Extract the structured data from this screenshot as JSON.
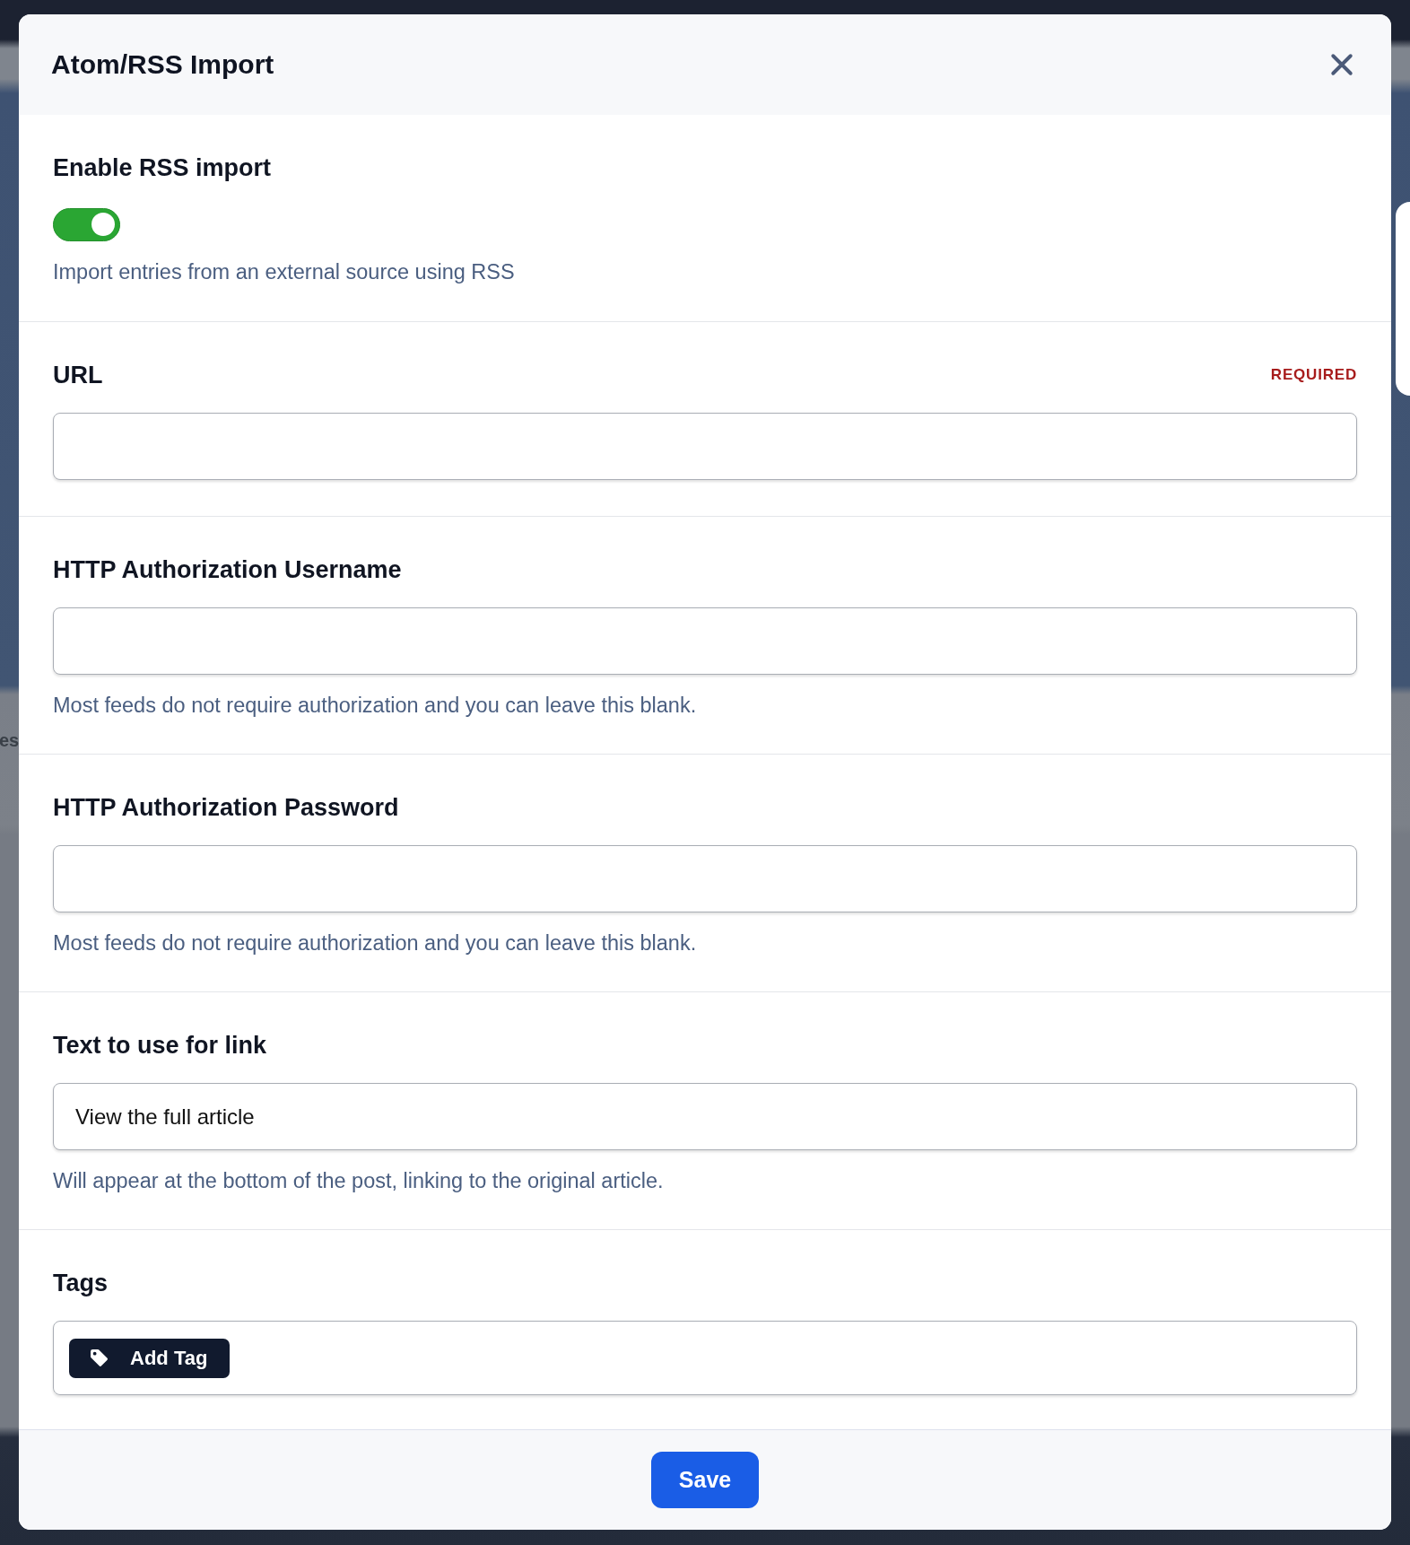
{
  "background": {
    "text_fragment": "es"
  },
  "dialog": {
    "title": "Atom/RSS Import"
  },
  "enable_import": {
    "label": "Enable RSS import",
    "on": true,
    "help": "Import entries from an external source using RSS"
  },
  "fields": [
    {
      "label": "URL",
      "badge": "REQUIRED"
    },
    {
      "label": "HTTP Authorization Username",
      "help": "Most feeds do not require authorization and you can leave this blank."
    },
    {
      "label": "HTTP Authorization Password",
      "help": "Most feeds do not require authorization and you can leave this blank."
    },
    {
      "label": "Text to use for link",
      "value": "View the full article",
      "help": "Will appear at the bottom of the post, linking to the original article."
    }
  ],
  "tags": {
    "label": "Tags",
    "add_button": "Add Tag"
  },
  "footer": {
    "save_button": "Save"
  }
}
